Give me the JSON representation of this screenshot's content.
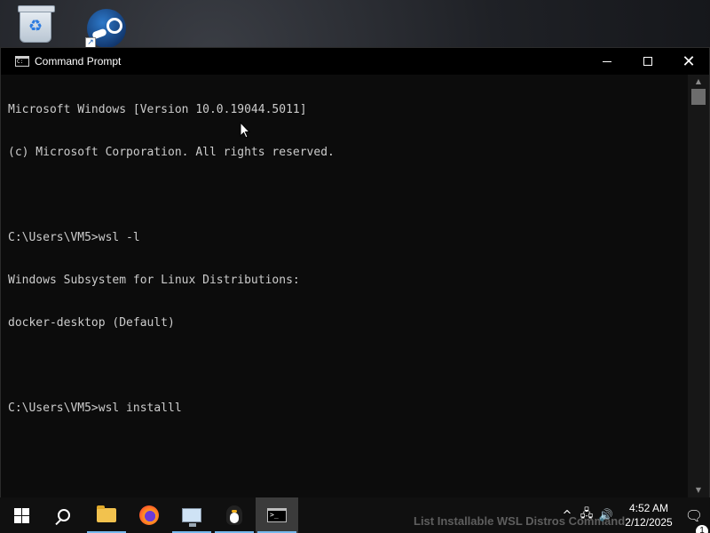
{
  "desktop": {
    "icons": [
      {
        "name": "recycle-bin",
        "icon": "recycle-bin-icon"
      },
      {
        "name": "steam",
        "icon": "steam-icon"
      }
    ]
  },
  "window": {
    "title": "Command Prompt",
    "icon": "cmd-icon",
    "controls": {
      "minimize": "minimize-icon",
      "maximize": "maximize-icon",
      "close": "✕"
    }
  },
  "console": {
    "lines": [
      "Microsoft Windows [Version 10.0.19044.5011]",
      "(c) Microsoft Corporation. All rights reserved.",
      "",
      "C:\\Users\\VM5>wsl -l",
      "Windows Subsystem for Linux Distributions:",
      "docker-desktop (Default)",
      "",
      "C:\\Users\\VM5>wsl installl"
    ],
    "text_color": "#cccccc",
    "background": "#0c0c0c"
  },
  "scrollbar": {
    "up_arrow": "▲",
    "down_arrow": "▼"
  },
  "taskbar": {
    "items": [
      {
        "name": "start",
        "icon": "windows-logo-icon"
      },
      {
        "name": "search",
        "icon": "search-icon"
      },
      {
        "name": "file-explorer",
        "icon": "folder-icon"
      },
      {
        "name": "firefox",
        "icon": "firefox-icon"
      },
      {
        "name": "remote-desktop",
        "icon": "remote-desktop-icon"
      },
      {
        "name": "linux",
        "icon": "penguin-icon"
      },
      {
        "name": "command-prompt",
        "icon": "cmd-icon",
        "active": true
      }
    ],
    "notification_text": "List Installable WSL Distros Command",
    "tray": {
      "chevron": "^",
      "network": "🖧",
      "volume": "🔊",
      "time": "4:52 AM",
      "date": "2/12/2025",
      "action_center_count": "1"
    },
    "accent": "#76b9ed"
  }
}
